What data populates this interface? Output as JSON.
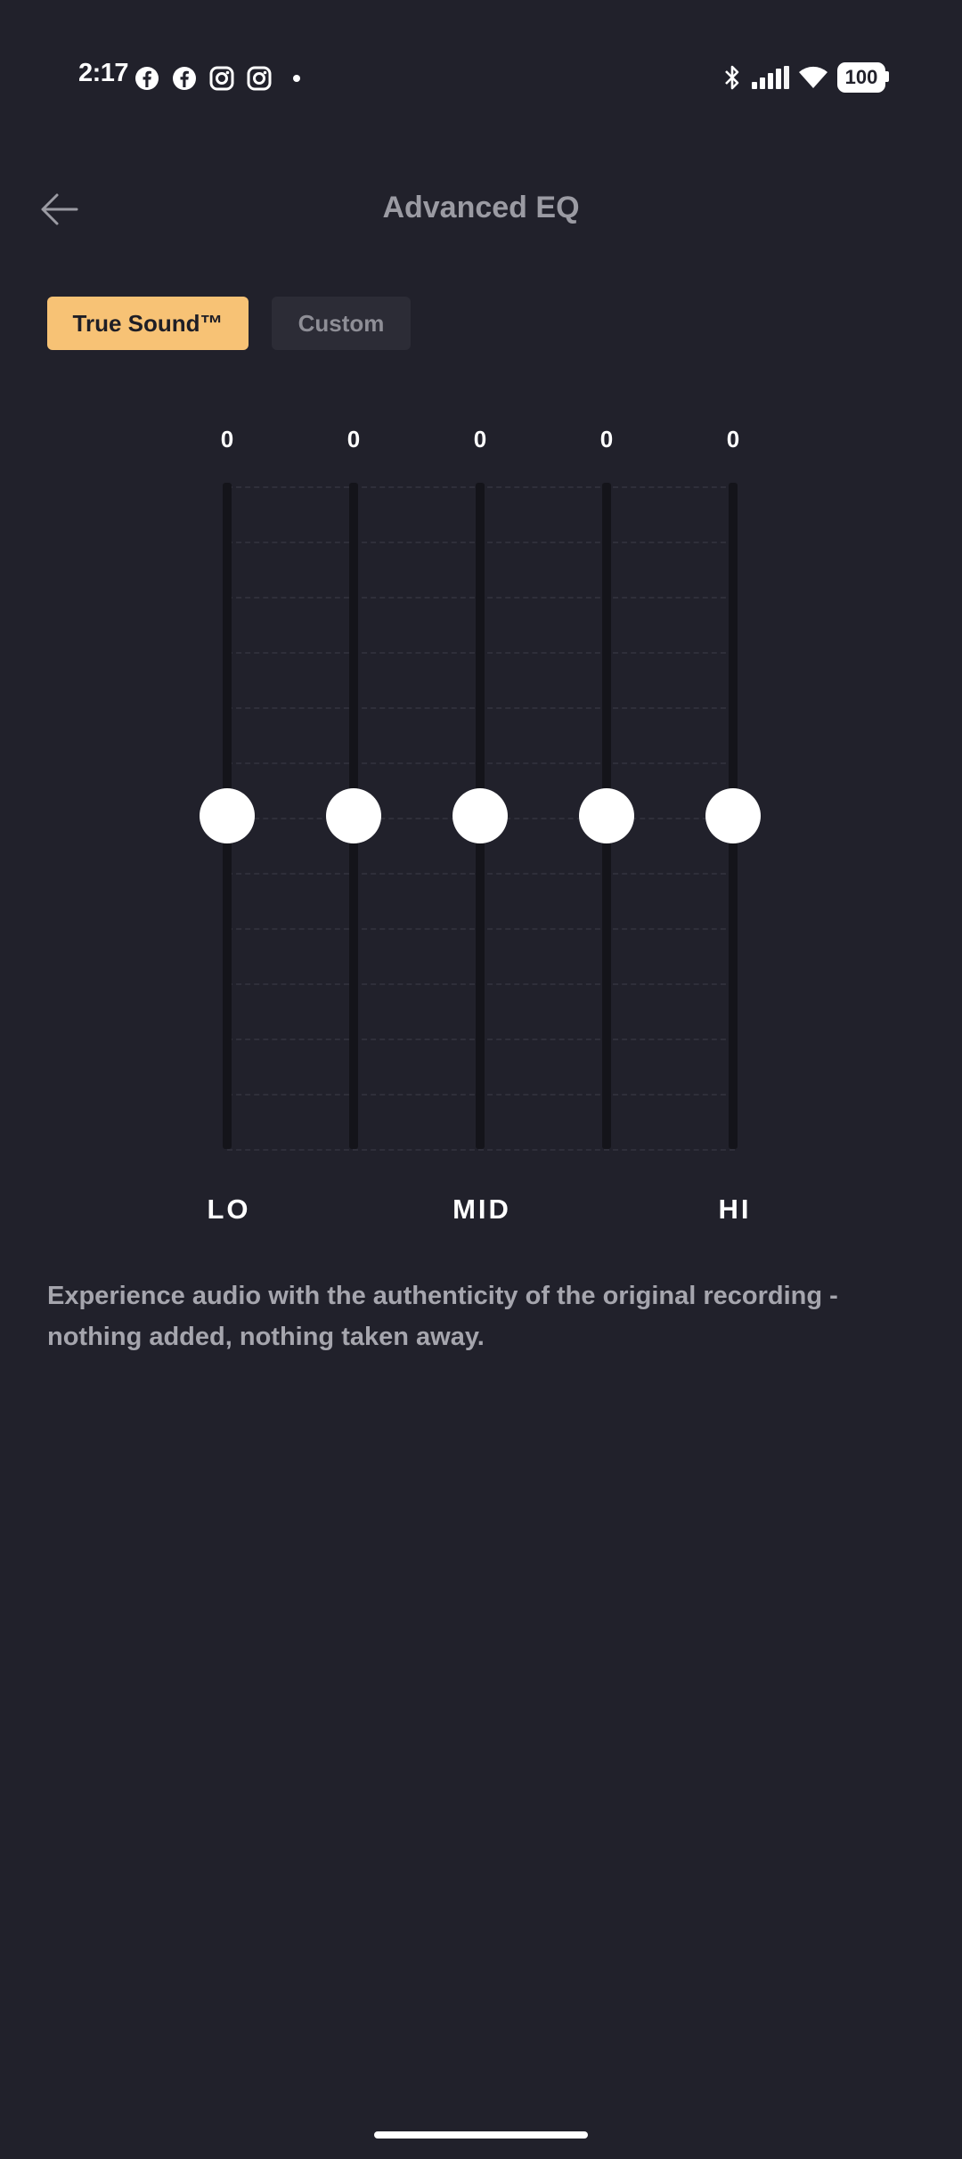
{
  "status_bar": {
    "time": "2:17",
    "battery": "100",
    "notification_icons": [
      "facebook-icon",
      "facebook-icon",
      "instagram-icon",
      "instagram-icon",
      "dot-icon"
    ],
    "system_icons": [
      "bluetooth-icon",
      "signal-icon",
      "wifi-icon",
      "battery-icon"
    ]
  },
  "header": {
    "title": "Advanced EQ",
    "back_icon": "arrow-left-icon"
  },
  "presets": {
    "active": "True Sound™",
    "inactive": "Custom"
  },
  "eq": {
    "bands": [
      {
        "value": "0"
      },
      {
        "value": "0"
      },
      {
        "value": "0"
      },
      {
        "value": "0"
      },
      {
        "value": "0"
      }
    ],
    "labels": [
      "LO",
      "MID",
      "HI"
    ]
  },
  "description": "Experience audio with the authenticity of the original recording - nothing added, nothing taken away.",
  "colors": {
    "background": "#21212b",
    "accent": "#f7c275",
    "knob": "#ffffff",
    "muted_text": "#a5a5ad"
  }
}
